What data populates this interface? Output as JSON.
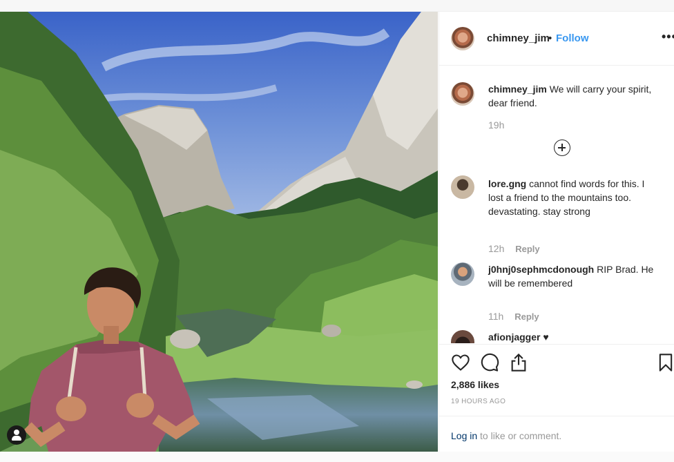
{
  "post": {
    "author": "chimney_jim",
    "separator": "•",
    "follow_label": "Follow",
    "more_label": "•••"
  },
  "comments": [
    {
      "user": "chimney_jim",
      "text": "We will carry your spirit, dear friend.",
      "time": "19h",
      "reply": ""
    },
    {
      "user": "lore.gng",
      "text": "cannot find words for this. I lost a friend to the mountains too. devastating. stay strong",
      "time": "12h",
      "reply": "Reply"
    },
    {
      "user": "j0hnj0sephmcdonough",
      "text": "RIP Brad. He will be remembered",
      "time": "11h",
      "reply": "Reply"
    },
    {
      "user": "afionjagger",
      "text": "♥",
      "time": "",
      "reply": ""
    }
  ],
  "footer": {
    "likes": "2,886 likes",
    "timestamp": "19 HOURS AGO",
    "login_link": "Log in",
    "login_rest": " to like or comment."
  },
  "icons": {
    "heart": "heart-icon",
    "comment": "comment-icon",
    "share": "share-icon",
    "save": "bookmark-icon",
    "load_more": "plus-circle-icon",
    "tagged": "user-tag-icon"
  },
  "colors": {
    "link": "#3897f0",
    "login_link": "#003569",
    "muted": "#999999"
  }
}
